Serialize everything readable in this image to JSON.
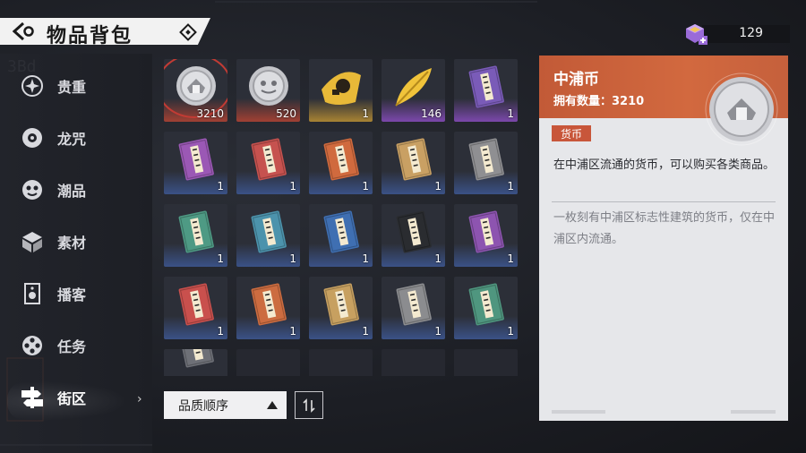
{
  "header": {
    "title": "物品背包"
  },
  "currency": {
    "value": "129",
    "icon": "purple-gem-icon"
  },
  "sidebar": {
    "items": [
      {
        "label": "贵重",
        "icon": "sparkle-icon"
      },
      {
        "label": "龙咒",
        "icon": "disc-icon"
      },
      {
        "label": "潮品",
        "icon": "mask-icon"
      },
      {
        "label": "素材",
        "icon": "cube-icon"
      },
      {
        "label": "播客",
        "icon": "speaker-icon"
      },
      {
        "label": "任务",
        "icon": "film-reel-icon"
      },
      {
        "label": "街区",
        "icon": "street-sign-icon",
        "active": true
      }
    ]
  },
  "inventory": {
    "items": [
      {
        "type": "coin",
        "count": "3210",
        "rarity": "red",
        "selected": true
      },
      {
        "type": "coin-alt",
        "count": "520",
        "rarity": "red"
      },
      {
        "type": "gold-badge",
        "count": "1",
        "rarity": "gold"
      },
      {
        "type": "gold-feather",
        "count": "146",
        "rarity": "purple"
      },
      {
        "type": "book",
        "color": "#7a5bb8",
        "count": "1",
        "rarity": "purple"
      },
      {
        "type": "book",
        "color": "#9b58b5",
        "count": "1",
        "rarity": "blue"
      },
      {
        "type": "book",
        "color": "#c6524f",
        "count": "1",
        "rarity": "blue"
      },
      {
        "type": "book",
        "color": "#d06a3e",
        "count": "1",
        "rarity": "blue"
      },
      {
        "type": "book",
        "color": "#c9a063",
        "count": "1",
        "rarity": "blue"
      },
      {
        "type": "book",
        "color": "#8f8f92",
        "count": "1",
        "rarity": "blue"
      },
      {
        "type": "book",
        "color": "#4e9a84",
        "count": "1",
        "rarity": "blue"
      },
      {
        "type": "book",
        "color": "#4c93ac",
        "count": "1",
        "rarity": "blue"
      },
      {
        "type": "book",
        "color": "#3f6fb2",
        "count": "1",
        "rarity": "blue"
      },
      {
        "type": "book",
        "color": "#2a2c30",
        "count": "1",
        "rarity": "blue"
      },
      {
        "type": "book",
        "color": "#8d54b0",
        "count": "1",
        "rarity": "blue"
      },
      {
        "type": "book",
        "color": "#c9504d",
        "count": "1",
        "rarity": "blue"
      },
      {
        "type": "book",
        "color": "#cc6c40",
        "count": "1",
        "rarity": "blue"
      },
      {
        "type": "book",
        "color": "#c7a060",
        "count": "1",
        "rarity": "blue"
      },
      {
        "type": "book",
        "color": "#8b8c8f",
        "count": "1",
        "rarity": "blue"
      },
      {
        "type": "book",
        "color": "#4f967f",
        "count": "1",
        "rarity": "blue"
      },
      {
        "type": "book",
        "color": "#6e7077",
        "count": "",
        "rarity": "grey",
        "partial": true
      }
    ]
  },
  "sort": {
    "label": "品质顺序",
    "order_icon": "sort-order-icon"
  },
  "detail": {
    "name": "中浦币",
    "owned": "拥有数量：3210",
    "tag": "货币",
    "description": "在中浦区流通的货币，可以购买各类商品。",
    "lore": "一枚刻有中浦区标志性建筑的货币，仅在中浦区内流通。",
    "accent": "#c85a38"
  }
}
